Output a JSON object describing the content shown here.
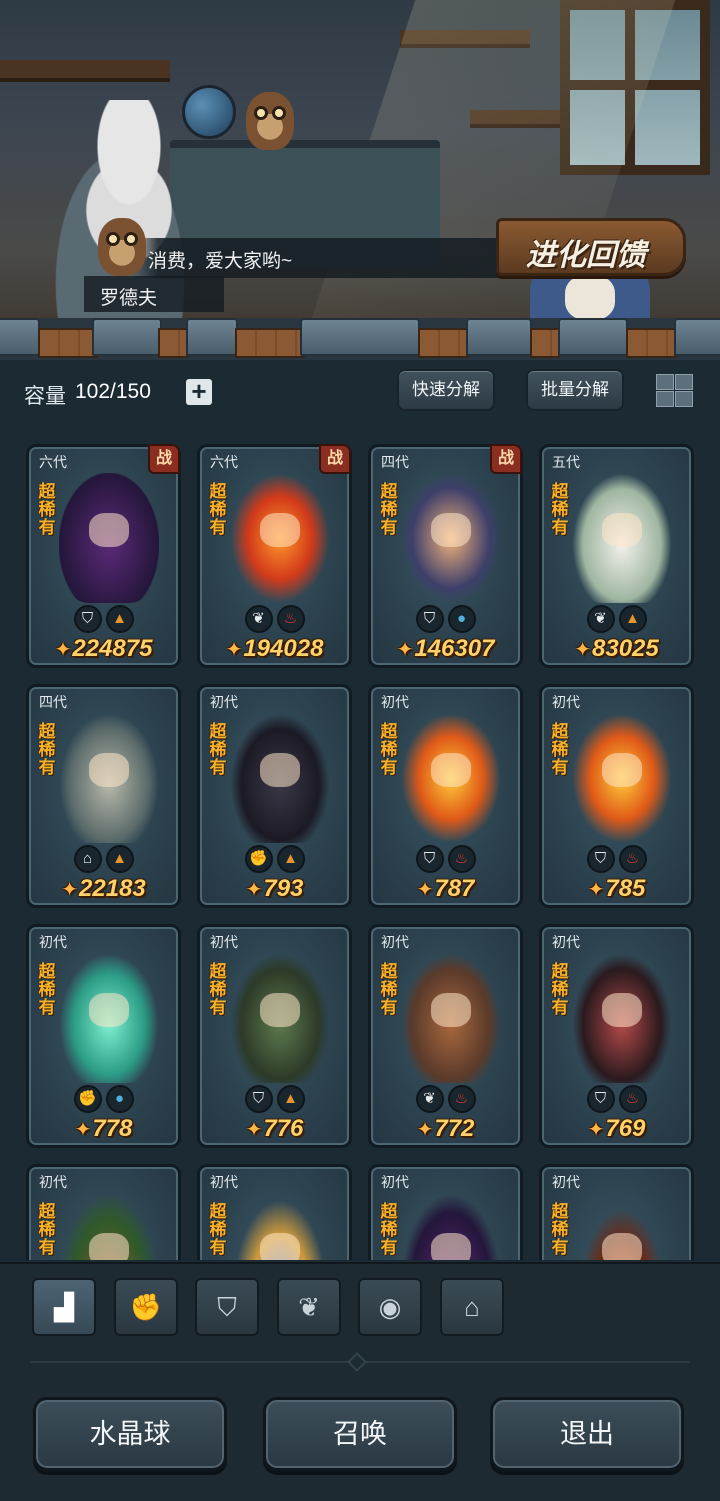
{
  "scene": {
    "dialog": "消费，爱大家哟~",
    "speaker": "罗德夫",
    "evolve_button": "进化回馈"
  },
  "capacity": {
    "label": "容量",
    "value": "102/150",
    "add_symbol": "+"
  },
  "toolbar": {
    "quick_decompose": "快速分解",
    "batch_decompose": "批量分解",
    "layout_icon": "grid-icon"
  },
  "rarity_label": "超稀有",
  "battle_tag": "战",
  "cards": [
    {
      "gen": "六代",
      "battle": true,
      "badges": [
        "shield",
        "earth"
      ],
      "power": "224875"
    },
    {
      "gen": "六代",
      "battle": true,
      "badges": [
        "leaf",
        "fire"
      ],
      "power": "194028"
    },
    {
      "gen": "四代",
      "battle": true,
      "badges": [
        "shield",
        "water"
      ],
      "power": "146307"
    },
    {
      "gen": "五代",
      "battle": false,
      "badges": [
        "leaf",
        "earth"
      ],
      "power": "83025"
    },
    {
      "gen": "四代",
      "battle": false,
      "badges": [
        "tower",
        "earth"
      ],
      "power": "22183"
    },
    {
      "gen": "初代",
      "battle": false,
      "badges": [
        "fist",
        "earth"
      ],
      "power": "793"
    },
    {
      "gen": "初代",
      "battle": false,
      "badges": [
        "shield",
        "fire"
      ],
      "power": "787"
    },
    {
      "gen": "初代",
      "battle": false,
      "badges": [
        "shield",
        "fire"
      ],
      "power": "785"
    },
    {
      "gen": "初代",
      "battle": false,
      "badges": [
        "fist",
        "water"
      ],
      "power": "778"
    },
    {
      "gen": "初代",
      "battle": false,
      "badges": [
        "shield",
        "earth"
      ],
      "power": "776"
    },
    {
      "gen": "初代",
      "battle": false,
      "badges": [
        "leaf",
        "fire"
      ],
      "power": "772"
    },
    {
      "gen": "初代",
      "battle": false,
      "badges": [
        "shield",
        "fire"
      ],
      "power": "769"
    },
    {
      "gen": "初代",
      "battle": false,
      "badges": [],
      "power": ""
    },
    {
      "gen": "初代",
      "battle": false,
      "badges": [],
      "power": ""
    },
    {
      "gen": "初代",
      "battle": false,
      "badges": [],
      "power": ""
    },
    {
      "gen": "初代",
      "battle": false,
      "badges": [],
      "power": ""
    }
  ],
  "filter_tabs": [
    {
      "icon": "all-blocks-icon",
      "active": true
    },
    {
      "icon": "fist-icon",
      "active": false
    },
    {
      "icon": "shield-icon",
      "active": false
    },
    {
      "icon": "sprout-icon",
      "active": false
    },
    {
      "icon": "orb-icon",
      "active": false
    },
    {
      "icon": "tower-icon",
      "active": false
    }
  ],
  "actions": {
    "crystal_ball": "水晶球",
    "summon": "召唤",
    "exit": "退出"
  },
  "colors": {
    "power_gold": "#ffd26a",
    "rarity_orange": "#f5b22a",
    "earth": "#e8952e",
    "water": "#4fb0e0",
    "fire": "#e0402f",
    "battle_red": "#8a2e22"
  }
}
